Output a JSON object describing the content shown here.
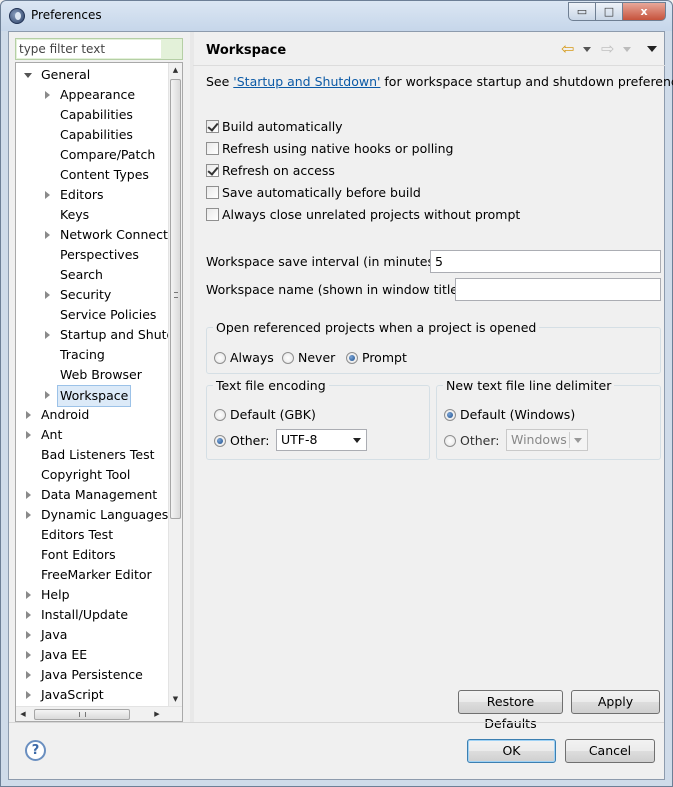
{
  "window": {
    "title": "Preferences",
    "controls": {
      "minimize": "▭",
      "maximize": "□",
      "close": "x"
    }
  },
  "filter": {
    "placeholder": "type filter text"
  },
  "tree": {
    "items": [
      {
        "label": "General",
        "depth": 0,
        "twisty": "open"
      },
      {
        "label": "Appearance",
        "depth": 1,
        "twisty": "closed"
      },
      {
        "label": "Capabilities",
        "depth": 1,
        "twisty": "none"
      },
      {
        "label": "Capabilities",
        "depth": 1,
        "twisty": "none"
      },
      {
        "label": "Compare/Patch",
        "depth": 1,
        "twisty": "none"
      },
      {
        "label": "Content Types",
        "depth": 1,
        "twisty": "none"
      },
      {
        "label": "Editors",
        "depth": 1,
        "twisty": "closed"
      },
      {
        "label": "Keys",
        "depth": 1,
        "twisty": "none"
      },
      {
        "label": "Network Connectio",
        "depth": 1,
        "twisty": "closed"
      },
      {
        "label": "Perspectives",
        "depth": 1,
        "twisty": "none"
      },
      {
        "label": "Search",
        "depth": 1,
        "twisty": "none"
      },
      {
        "label": "Security",
        "depth": 1,
        "twisty": "closed"
      },
      {
        "label": "Service Policies",
        "depth": 1,
        "twisty": "none"
      },
      {
        "label": "Startup and Shutd",
        "depth": 1,
        "twisty": "closed"
      },
      {
        "label": "Tracing",
        "depth": 1,
        "twisty": "none"
      },
      {
        "label": "Web Browser",
        "depth": 1,
        "twisty": "none"
      },
      {
        "label": "Workspace",
        "depth": 1,
        "twisty": "closed",
        "selected": true
      },
      {
        "label": "Android",
        "depth": 0,
        "twisty": "closed"
      },
      {
        "label": "Ant",
        "depth": 0,
        "twisty": "closed"
      },
      {
        "label": "Bad Listeners Test",
        "depth": 0,
        "twisty": "none"
      },
      {
        "label": "Copyright Tool",
        "depth": 0,
        "twisty": "none"
      },
      {
        "label": "Data Management",
        "depth": 0,
        "twisty": "closed"
      },
      {
        "label": "Dynamic Languages",
        "depth": 0,
        "twisty": "closed"
      },
      {
        "label": "Editors Test",
        "depth": 0,
        "twisty": "none"
      },
      {
        "label": "Font Editors",
        "depth": 0,
        "twisty": "none"
      },
      {
        "label": "FreeMarker Editor",
        "depth": 0,
        "twisty": "none"
      },
      {
        "label": "Help",
        "depth": 0,
        "twisty": "closed"
      },
      {
        "label": "Install/Update",
        "depth": 0,
        "twisty": "closed"
      },
      {
        "label": "Java",
        "depth": 0,
        "twisty": "closed"
      },
      {
        "label": "Java EE",
        "depth": 0,
        "twisty": "closed"
      },
      {
        "label": "Java Persistence",
        "depth": 0,
        "twisty": "closed"
      },
      {
        "label": "JavaScript",
        "depth": 0,
        "twisty": "closed"
      }
    ],
    "scroll_up": "▲",
    "scroll_down": "▼",
    "scroll_left": "◀",
    "scroll_right": "▶"
  },
  "page": {
    "title": "Workspace",
    "nav_back_icon": "⇦",
    "nav_forward_icon": "⇨",
    "desc_prefix": "See ",
    "desc_link": "'Startup and Shutdown'",
    "desc_suffix": " for workspace startup and shutdown preferences.",
    "checkboxes": [
      {
        "label": "Build automatically",
        "checked": true
      },
      {
        "label": "Refresh using native hooks or polling",
        "checked": false
      },
      {
        "label": "Refresh on access",
        "checked": true
      },
      {
        "label": "Save automatically before build",
        "checked": false
      },
      {
        "label": "Always close unrelated projects without prompt",
        "checked": false
      }
    ],
    "save_interval_label": "Workspace save interval (in minutes):",
    "save_interval_value": "5",
    "workspace_name_label": "Workspace name (shown in window title):",
    "workspace_name_value": "",
    "open_projects": {
      "legend": "Open referenced projects when a project is opened",
      "options": [
        {
          "label": "Always",
          "selected": false
        },
        {
          "label": "Never",
          "selected": false
        },
        {
          "label": "Prompt",
          "selected": true
        }
      ]
    },
    "encoding": {
      "legend": "Text file encoding",
      "default_label": "Default (GBK)",
      "default_selected": false,
      "other_label": "Other:",
      "other_selected": true,
      "other_value": "UTF-8"
    },
    "line_delimiter": {
      "legend": "New text file line delimiter",
      "default_label": "Default (Windows)",
      "default_selected": true,
      "other_label": "Other:",
      "other_selected": false,
      "other_value": "Windows"
    },
    "restore_defaults_label": "Restore Defaults",
    "apply_label": "Apply"
  },
  "footer": {
    "help_icon": "?",
    "ok_label": "OK",
    "cancel_label": "Cancel"
  }
}
